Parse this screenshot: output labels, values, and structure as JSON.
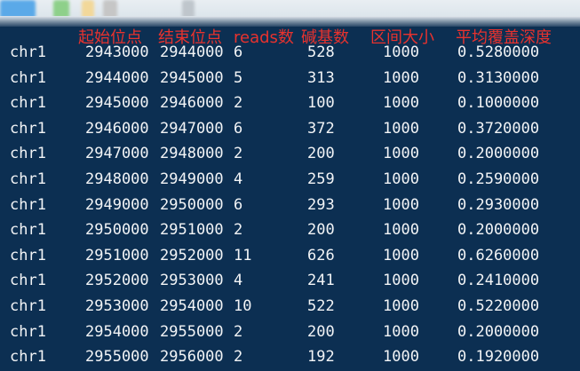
{
  "header": {
    "start": "起始位点",
    "end": "结束位点",
    "reads": "reads数",
    "base": "碱基数",
    "size": "区间大小",
    "avg": "平均覆盖深度"
  },
  "rows": [
    {
      "chr": "chr1",
      "start": "2943000",
      "end": "2944000",
      "reads": "6",
      "base": "528",
      "size": "1000",
      "avg": "0.5280000"
    },
    {
      "chr": "chr1",
      "start": "2944000",
      "end": "2945000",
      "reads": "5",
      "base": "313",
      "size": "1000",
      "avg": "0.3130000"
    },
    {
      "chr": "chr1",
      "start": "2945000",
      "end": "2946000",
      "reads": "2",
      "base": "100",
      "size": "1000",
      "avg": "0.1000000"
    },
    {
      "chr": "chr1",
      "start": "2946000",
      "end": "2947000",
      "reads": "6",
      "base": "372",
      "size": "1000",
      "avg": "0.3720000"
    },
    {
      "chr": "chr1",
      "start": "2947000",
      "end": "2948000",
      "reads": "2",
      "base": "200",
      "size": "1000",
      "avg": "0.2000000"
    },
    {
      "chr": "chr1",
      "start": "2948000",
      "end": "2949000",
      "reads": "4",
      "base": "259",
      "size": "1000",
      "avg": "0.2590000"
    },
    {
      "chr": "chr1",
      "start": "2949000",
      "end": "2950000",
      "reads": "6",
      "base": "293",
      "size": "1000",
      "avg": "0.2930000"
    },
    {
      "chr": "chr1",
      "start": "2950000",
      "end": "2951000",
      "reads": "2",
      "base": "200",
      "size": "1000",
      "avg": "0.2000000"
    },
    {
      "chr": "chr1",
      "start": "2951000",
      "end": "2952000",
      "reads": "11",
      "base": "626",
      "size": "1000",
      "avg": "0.6260000"
    },
    {
      "chr": "chr1",
      "start": "2952000",
      "end": "2953000",
      "reads": "4",
      "base": "241",
      "size": "1000",
      "avg": "0.2410000"
    },
    {
      "chr": "chr1",
      "start": "2953000",
      "end": "2954000",
      "reads": "10",
      "base": "522",
      "size": "1000",
      "avg": "0.5220000"
    },
    {
      "chr": "chr1",
      "start": "2954000",
      "end": "2955000",
      "reads": "2",
      "base": "200",
      "size": "1000",
      "avg": "0.2000000"
    },
    {
      "chr": "chr1",
      "start": "2955000",
      "end": "2956000",
      "reads": "2",
      "base": "192",
      "size": "1000",
      "avg": "0.1920000"
    }
  ]
}
